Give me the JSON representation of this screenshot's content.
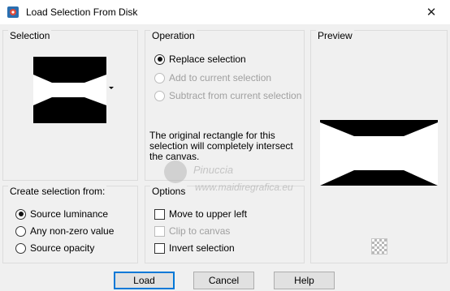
{
  "window": {
    "title": "Load Selection From Disk",
    "close_glyph": "✕",
    "app_icon": "paint-shop-pro-icon"
  },
  "selection": {
    "label": "Selection"
  },
  "operation": {
    "label": "Operation",
    "options": [
      {
        "label": "Replace selection",
        "checked": true,
        "enabled": true
      },
      {
        "label": "Add to current selection",
        "checked": false,
        "enabled": false
      },
      {
        "label": "Subtract from current selection",
        "checked": false,
        "enabled": false
      }
    ],
    "info": "The original rectangle for this selection will completely intersect the canvas."
  },
  "preview": {
    "label": "Preview",
    "zoom_icon": "zoom-to-fit-icon"
  },
  "create_from": {
    "label": "Create selection from:",
    "options": [
      {
        "label": "Source luminance",
        "checked": true
      },
      {
        "label": "Any non-zero value",
        "checked": false
      },
      {
        "label": "Source opacity",
        "checked": false
      }
    ]
  },
  "options": {
    "label": "Options",
    "items": [
      {
        "label": "Move to upper left",
        "checked": false,
        "enabled": true
      },
      {
        "label": "Clip to canvas",
        "checked": false,
        "enabled": false
      },
      {
        "label": "Invert selection",
        "checked": false,
        "enabled": true
      }
    ]
  },
  "buttons": {
    "load": "Load",
    "cancel": "Cancel",
    "help": "Help"
  },
  "watermark": {
    "line1": "Pinuccia",
    "line2": "www.maidiregrafica.eu"
  },
  "colors": {
    "accent": "#0078d7",
    "dialog_bg": "#f0f0f0"
  }
}
